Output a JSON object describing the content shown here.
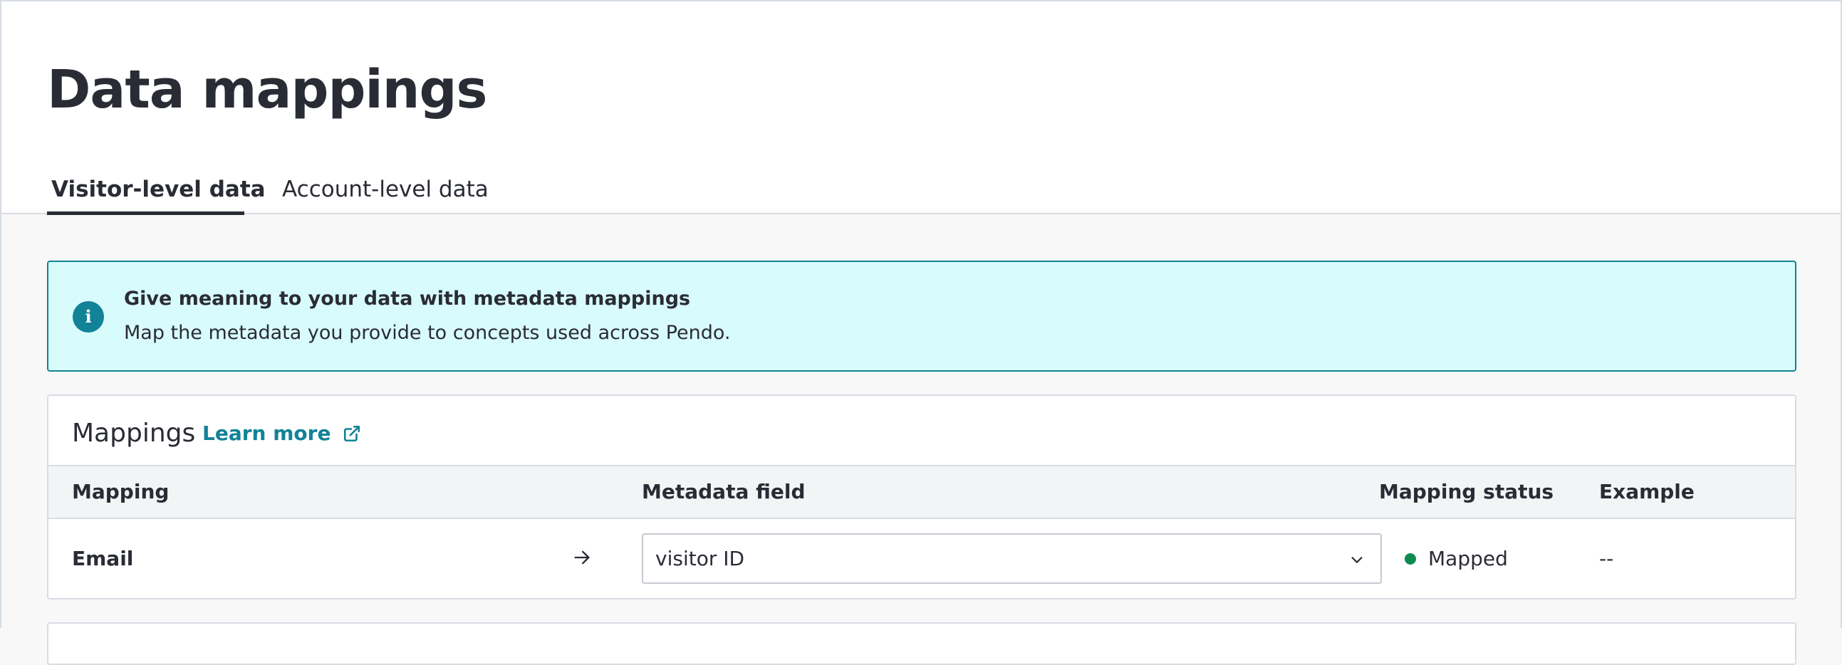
{
  "page": {
    "title": "Data mappings"
  },
  "tabs": [
    {
      "label": "Visitor-level data",
      "active": true
    },
    {
      "label": "Account-level data",
      "active": false
    }
  ],
  "banner": {
    "icon": "info-icon",
    "title": "Give meaning to your data with metadata mappings",
    "text": "Map the metadata you provide to concepts used across Pendo."
  },
  "mappings": {
    "title": "Mappings",
    "learn_more": "Learn more",
    "columns": {
      "mapping": "Mapping",
      "metadata_field": "Metadata field",
      "mapping_status": "Mapping status",
      "example": "Example"
    },
    "rows": [
      {
        "mapping": "Email",
        "metadata_field": "visitor ID",
        "status": "Mapped",
        "example": "--"
      }
    ]
  },
  "colors": {
    "accent": "#128297",
    "banner_bg": "#d8fbfc",
    "status_mapped": "#0c8b4e",
    "text": "#2a2c35"
  }
}
